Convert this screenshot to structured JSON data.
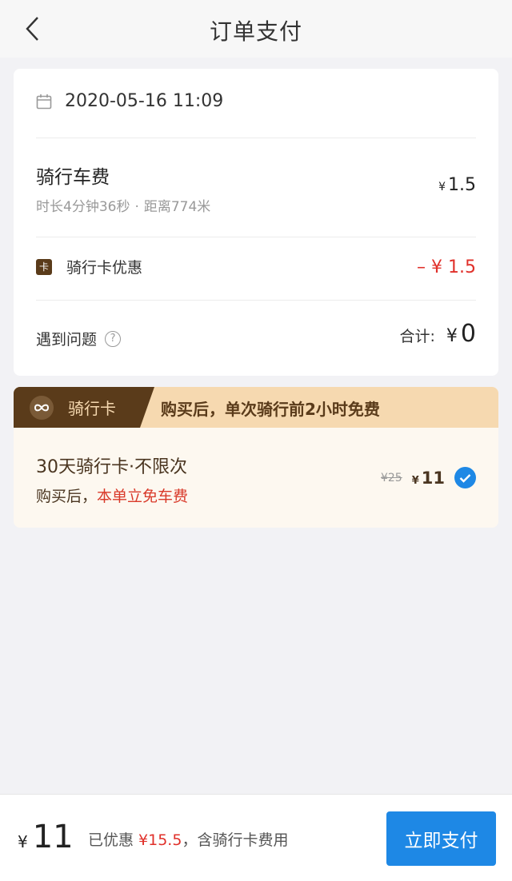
{
  "header": {
    "title": "订单支付"
  },
  "order": {
    "datetime": "2020-05-16 11:09",
    "fee": {
      "title": "骑行车费",
      "duration": "时长4分钟36秒",
      "separator": "·",
      "distance": "距离774米",
      "yen": "¥",
      "amount": "1.5"
    },
    "discount": {
      "icon_text": "卡",
      "label": "骑行卡优惠",
      "amount": "– ¥ 1.5"
    },
    "problem_label": "遇到问题",
    "help_glyph": "?",
    "total": {
      "label": "合计:",
      "yen": "¥",
      "value": "0"
    }
  },
  "pass": {
    "tag": "骑行卡",
    "banner": "购买后，单次骑行前2小时免费",
    "title": "30天骑行卡·不限次",
    "sub_prefix": "购买后，",
    "sub_highlight": "本单立免车费",
    "orig_price": "¥25",
    "yen": "¥",
    "price": "11",
    "selected": true
  },
  "footer": {
    "yen": "¥",
    "amount": "11",
    "saved_prefix": "已优惠 ",
    "saved_amount": "¥15.5",
    "saved_suffix": "，含骑行卡费用",
    "pay_label": "立即支付"
  },
  "colors": {
    "accent": "#1e88e5",
    "discount_red": "#e0302a",
    "brown": "#5a3b1a",
    "banner": "#f6d9b0"
  }
}
